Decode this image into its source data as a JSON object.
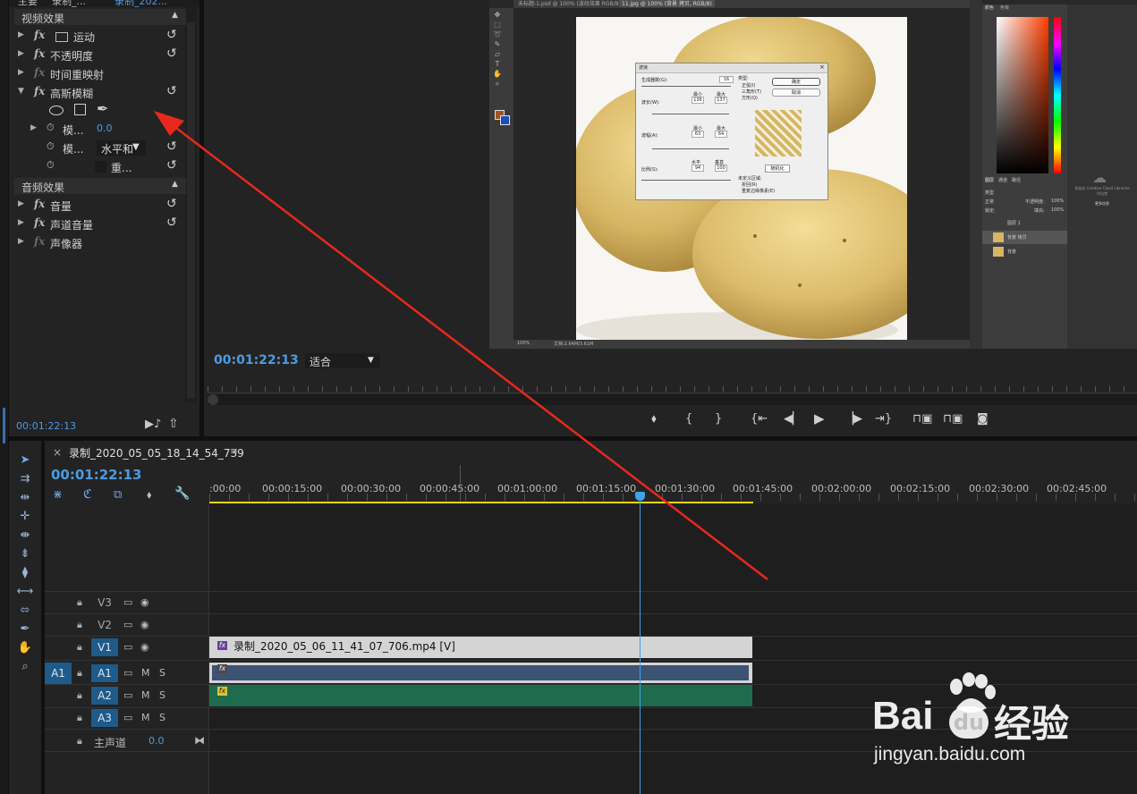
{
  "effect_controls": {
    "tabs": [
      "主要",
      "录制_...",
      "录制_202..."
    ],
    "video_section": "视频效果",
    "effects": [
      {
        "name": "运动",
        "dim": false
      },
      {
        "name": "不透明度",
        "dim": false
      },
      {
        "name": "时间重映射",
        "dim": true
      },
      {
        "name": "高斯模糊",
        "dim": false
      }
    ],
    "params": [
      {
        "name": "模...",
        "value": "0.0"
      },
      {
        "name": "模...",
        "value": "水平和"
      },
      {
        "name": "重..."
      }
    ],
    "audio_section": "音频效果",
    "audio_effects": [
      {
        "name": "音量",
        "dim": false
      },
      {
        "name": "声道音量",
        "dim": false
      },
      {
        "name": "声像器",
        "dim": true
      }
    ],
    "timecode": "00:01:22:13"
  },
  "program_monitor": {
    "timecode": "00:01:22:13",
    "fit": "适合"
  },
  "photoshop": {
    "tabs": [
      "未标题-1.psd @ 100% (波纹效果 RGB/8)",
      "11.jpg @ 100% (背景 拷贝, RGB/8)"
    ],
    "dialog": {
      "title": "波浪",
      "ok": "确定",
      "cancel": "取消",
      "randomize": "随机化",
      "generators_label": "生成器数(G):",
      "generators_value": "16",
      "wavelength_label": "波长(W):",
      "amplitude_label": "波幅(A):",
      "scale_label": "比例(S):",
      "type_label": "类型:",
      "types": [
        "正弦(I)",
        "三角形(T)",
        "方形(Q)"
      ],
      "min": "最小",
      "max": "最大",
      "wl_min": "136",
      "wl_max": "137",
      "amp_min": "63",
      "amp_max": "64",
      "horizontal": "水平",
      "vertical": "垂直",
      "scale_h": "94",
      "scale_v": "100",
      "undefined_label": "未定义区域:",
      "wrap": "折回(R)",
      "repeat": "重复边缘像素(E)"
    },
    "status_zoom": "100%",
    "status_doc": "文档:2.64M/3.61M",
    "panels": {
      "color_tabs": [
        "颜色",
        "色板"
      ],
      "layers_tabs": [
        "图层",
        "通道",
        "路径"
      ],
      "kind": "类型",
      "blend": "正常",
      "opacity_label": "不透明度:",
      "opacity": "100%",
      "lock": "锁定:",
      "fill_label": "填充:",
      "fill": "100%",
      "layers": [
        "图层 1",
        "背景 拷贝",
        "背景"
      ],
      "cc_text": "初始化 Creative Cloud Libraries 时出错",
      "cc_link": "更多信息"
    }
  },
  "timeline": {
    "sequence_name": "录制_2020_05_05_18_14_54_739",
    "timecode": "00:01:22:13",
    "ruler": [
      ":00:00",
      "00:00:15:00",
      "00:00:30:00",
      "00:00:45:00",
      "00:01:00:00",
      "00:01:15:00",
      "00:01:30:00",
      "00:01:45:00",
      "00:02:00:00",
      "00:02:15:00",
      "00:02:30:00",
      "00:02:45:00"
    ],
    "tracks": [
      {
        "name": "V3"
      },
      {
        "name": "V2"
      },
      {
        "name": "V1",
        "on": true
      },
      {
        "name": "A1",
        "on": true,
        "src": "A1"
      },
      {
        "name": "A2",
        "on": true
      },
      {
        "name": "A3",
        "on": true
      }
    ],
    "master_label": "主声道",
    "master_value": "0.0",
    "video_clip": "录制_2020_05_06_11_41_07_706.mp4 [V]",
    "fx_badge": "fx",
    "m": "M",
    "s": "S"
  },
  "watermark": {
    "brand_left": "Bai",
    "brand_right": "经验",
    "url": "jingyan.baidu.com"
  },
  "colors": {
    "accent_blue": "#4d9be0",
    "annotation_red": "#e8281e",
    "audio_clip": "#1f6b4e",
    "video_clip": "#d4d4d4"
  }
}
